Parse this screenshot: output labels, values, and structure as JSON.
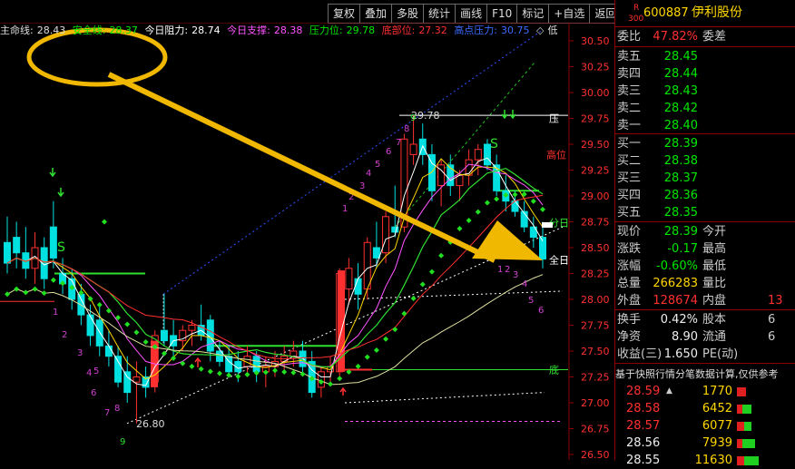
{
  "toolbar": {
    "buttons": [
      "复权",
      "叠加",
      "多股",
      "统计",
      "画线",
      "F10",
      "标记",
      "+自选",
      "返回"
    ]
  },
  "indicators": {
    "life_line_label": "主命线:",
    "life_line_value": "28.43",
    "safety_line_label": "安全线:",
    "safety_line_value": "28.37",
    "today_resist_label": "今日阻力:",
    "today_resist_value": "28.74",
    "today_support_label": "今日支撑:",
    "today_support_value": "28.38",
    "pressure_label": "压力位:",
    "pressure_value": "29.78",
    "bottom_label": "底部位:",
    "bottom_value": "27.32",
    "high_pressure_label": "高点压力:",
    "high_pressure_value": "30.75",
    "tail": "低"
  },
  "chart_data": {
    "type": "candlestick",
    "y_ticks": [
      "30.50",
      "30.25",
      "30.00",
      "29.75",
      "29.50",
      "29.25",
      "29.00",
      "28.75",
      "28.50",
      "28.25",
      "28.00",
      "27.75",
      "27.50",
      "27.25",
      "27.00",
      "26.75",
      "26.50"
    ],
    "ylim": [
      26.5,
      30.5
    ],
    "annotations": {
      "high_marker": "29.78",
      "low_marker": "26.80",
      "S_buy": "S",
      "S_sell": "S",
      "labels_right": [
        "压",
        "高位",
        "分日",
        "全日",
        "底"
      ],
      "seq_left": [
        "1",
        "2",
        "3",
        "4",
        "5",
        "6",
        "7",
        "8",
        "9"
      ],
      "seq_right_up": [
        "1",
        "2",
        "3",
        "4",
        "5",
        "6",
        "7",
        "8",
        "9"
      ],
      "seq_right_down": [
        "1",
        "2",
        "3",
        "4",
        "5",
        "6"
      ]
    },
    "candles": [
      {
        "o": 28.55,
        "h": 28.8,
        "l": 28.25,
        "c": 28.35
      },
      {
        "o": 28.6,
        "h": 28.75,
        "l": 28.3,
        "c": 28.45
      },
      {
        "o": 28.45,
        "h": 28.7,
        "l": 28.2,
        "c": 28.3
      },
      {
        "o": 28.3,
        "h": 28.65,
        "l": 28.15,
        "c": 28.5
      },
      {
        "o": 28.5,
        "h": 28.6,
        "l": 28.1,
        "c": 28.2
      },
      {
        "o": 28.7,
        "h": 28.95,
        "l": 28.3,
        "c": 28.4
      },
      {
        "o": 28.25,
        "h": 28.4,
        "l": 28.05,
        "c": 28.15
      },
      {
        "o": 28.2,
        "h": 28.3,
        "l": 27.9,
        "c": 28.0
      },
      {
        "o": 28.05,
        "h": 28.15,
        "l": 27.75,
        "c": 27.85
      },
      {
        "o": 27.85,
        "h": 27.95,
        "l": 27.55,
        "c": 27.65
      },
      {
        "o": 27.8,
        "h": 27.95,
        "l": 27.45,
        "c": 27.55
      },
      {
        "o": 27.55,
        "h": 27.7,
        "l": 27.35,
        "c": 27.45
      },
      {
        "o": 27.45,
        "h": 27.55,
        "l": 27.15,
        "c": 27.2
      },
      {
        "o": 27.3,
        "h": 27.45,
        "l": 27.0,
        "c": 27.1
      },
      {
        "o": 27.2,
        "h": 27.4,
        "l": 26.8,
        "c": 27.25
      },
      {
        "o": 27.25,
        "h": 27.35,
        "l": 27.05,
        "c": 27.15
      },
      {
        "o": 27.2,
        "h": 27.7,
        "l": 27.1,
        "c": 27.65
      },
      {
        "o": 27.7,
        "h": 28.05,
        "l": 27.55,
        "c": 27.6
      },
      {
        "o": 27.65,
        "h": 27.8,
        "l": 27.45,
        "c": 27.55
      },
      {
        "o": 27.6,
        "h": 27.75,
        "l": 27.5,
        "c": 27.7
      },
      {
        "o": 27.7,
        "h": 27.8,
        "l": 27.55,
        "c": 27.75
      },
      {
        "o": 27.75,
        "h": 27.95,
        "l": 27.6,
        "c": 27.65
      },
      {
        "o": 27.8,
        "h": 27.85,
        "l": 27.4,
        "c": 27.5
      },
      {
        "o": 27.5,
        "h": 27.6,
        "l": 27.35,
        "c": 27.4
      },
      {
        "o": 27.45,
        "h": 27.55,
        "l": 27.25,
        "c": 27.3
      },
      {
        "o": 27.4,
        "h": 27.5,
        "l": 27.2,
        "c": 27.3
      },
      {
        "o": 27.35,
        "h": 27.55,
        "l": 27.25,
        "c": 27.45
      },
      {
        "o": 27.45,
        "h": 27.5,
        "l": 27.2,
        "c": 27.3
      },
      {
        "o": 27.3,
        "h": 27.45,
        "l": 27.15,
        "c": 27.35
      },
      {
        "o": 27.35,
        "h": 27.5,
        "l": 27.25,
        "c": 27.4
      },
      {
        "o": 27.4,
        "h": 27.55,
        "l": 27.3,
        "c": 27.45
      },
      {
        "o": 27.45,
        "h": 27.6,
        "l": 27.35,
        "c": 27.5
      },
      {
        "o": 27.5,
        "h": 27.6,
        "l": 27.3,
        "c": 27.35
      },
      {
        "o": 27.4,
        "h": 27.5,
        "l": 27.05,
        "c": 27.1
      },
      {
        "o": 27.15,
        "h": 27.35,
        "l": 27.05,
        "c": 27.3
      },
      {
        "o": 27.3,
        "h": 27.45,
        "l": 27.2,
        "c": 27.35
      },
      {
        "o": 27.3,
        "h": 28.3,
        "l": 27.25,
        "c": 28.25
      },
      {
        "o": 28.1,
        "h": 28.4,
        "l": 27.95,
        "c": 28.3
      },
      {
        "o": 28.2,
        "h": 28.35,
        "l": 27.9,
        "c": 28.05
      },
      {
        "o": 28.1,
        "h": 28.6,
        "l": 28.0,
        "c": 28.55
      },
      {
        "o": 28.5,
        "h": 28.75,
        "l": 28.3,
        "c": 28.4
      },
      {
        "o": 28.45,
        "h": 28.85,
        "l": 28.35,
        "c": 28.8
      },
      {
        "o": 28.7,
        "h": 29.1,
        "l": 28.6,
        "c": 28.65
      },
      {
        "o": 28.7,
        "h": 29.6,
        "l": 28.65,
        "c": 29.55
      },
      {
        "o": 29.4,
        "h": 29.78,
        "l": 29.3,
        "c": 29.5
      },
      {
        "o": 29.55,
        "h": 29.7,
        "l": 29.3,
        "c": 29.4
      },
      {
        "o": 29.4,
        "h": 29.5,
        "l": 28.95,
        "c": 29.05
      },
      {
        "o": 29.1,
        "h": 29.35,
        "l": 28.9,
        "c": 29.3
      },
      {
        "o": 29.3,
        "h": 29.4,
        "l": 29.0,
        "c": 29.1
      },
      {
        "o": 29.1,
        "h": 29.25,
        "l": 28.95,
        "c": 29.2
      },
      {
        "o": 29.2,
        "h": 29.45,
        "l": 29.1,
        "c": 29.35
      },
      {
        "o": 29.35,
        "h": 29.5,
        "l": 29.2,
        "c": 29.45
      },
      {
        "o": 29.5,
        "h": 29.55,
        "l": 29.25,
        "c": 29.3
      },
      {
        "o": 29.3,
        "h": 29.4,
        "l": 29.0,
        "c": 29.05
      },
      {
        "o": 29.05,
        "h": 29.2,
        "l": 28.85,
        "c": 28.95
      },
      {
        "o": 28.95,
        "h": 29.05,
        "l": 28.8,
        "c": 28.85
      },
      {
        "o": 28.85,
        "h": 28.95,
        "l": 28.65,
        "c": 28.7
      },
      {
        "o": 28.7,
        "h": 28.8,
        "l": 28.5,
        "c": 28.6
      },
      {
        "o": 28.6,
        "h": 28.75,
        "l": 28.3,
        "c": 28.39
      }
    ]
  },
  "quote": {
    "badge_r": "R",
    "badge_num": "300",
    "code": "600887",
    "name": "伊利股份",
    "weibi_label": "委比",
    "weibi_value": "47.82%",
    "weicha_label": "委差",
    "asks": [
      {
        "label": "卖五",
        "price": "28.45"
      },
      {
        "label": "卖四",
        "price": "28.44"
      },
      {
        "label": "卖三",
        "price": "28.43"
      },
      {
        "label": "卖二",
        "price": "28.42"
      },
      {
        "label": "卖一",
        "price": "28.40"
      }
    ],
    "bids": [
      {
        "label": "买一",
        "price": "28.39"
      },
      {
        "label": "买二",
        "price": "28.38"
      },
      {
        "label": "买三",
        "price": "28.37"
      },
      {
        "label": "买四",
        "price": "28.36"
      },
      {
        "label": "买五",
        "price": "28.35"
      }
    ],
    "stats": [
      {
        "l1": "现价",
        "v1": "28.39",
        "l2": "今开",
        "v2": "",
        "c": "green"
      },
      {
        "l1": "涨跌",
        "v1": "-0.17",
        "l2": "最高",
        "v2": "",
        "c": "green"
      },
      {
        "l1": "涨幅",
        "v1": "-0.60%",
        "l2": "最低",
        "v2": "",
        "c": "green"
      },
      {
        "l1": "总量",
        "v1": "266283",
        "l2": "量比",
        "v2": "",
        "c": "yellow"
      },
      {
        "l1": "外盘",
        "v1": "128674",
        "l2": "内盘",
        "v2": "13",
        "c": "red"
      }
    ],
    "stats2": [
      {
        "l1": "换手",
        "v1": "0.42%",
        "l2": "股本",
        "v2": "6"
      },
      {
        "l1": "净资",
        "v1": "8.90",
        "l2": "流通",
        "v2": "6"
      },
      {
        "l1": "收益(三)",
        "v1": "1.650",
        "l2": "PE(动)",
        "v2": ""
      }
    ],
    "note": "基于快照行情分笔数据计算,仅供参考",
    "ticks": [
      {
        "price": "28.59",
        "arrow": "▲",
        "vol": "1770",
        "pc": "red",
        "bar": [
          10,
          0
        ]
      },
      {
        "price": "28.58",
        "arrow": "",
        "vol": "6452",
        "pc": "red",
        "bar": [
          6,
          10
        ]
      },
      {
        "price": "28.57",
        "arrow": "",
        "vol": "6077",
        "pc": "red",
        "bar": [
          8,
          8
        ]
      },
      {
        "price": "28.56",
        "arrow": "",
        "vol": "7939",
        "pc": "white",
        "bar": [
          6,
          14
        ]
      },
      {
        "price": "28.55",
        "arrow": "",
        "vol": "11630",
        "pc": "white",
        "bar": [
          8,
          16
        ]
      }
    ]
  }
}
